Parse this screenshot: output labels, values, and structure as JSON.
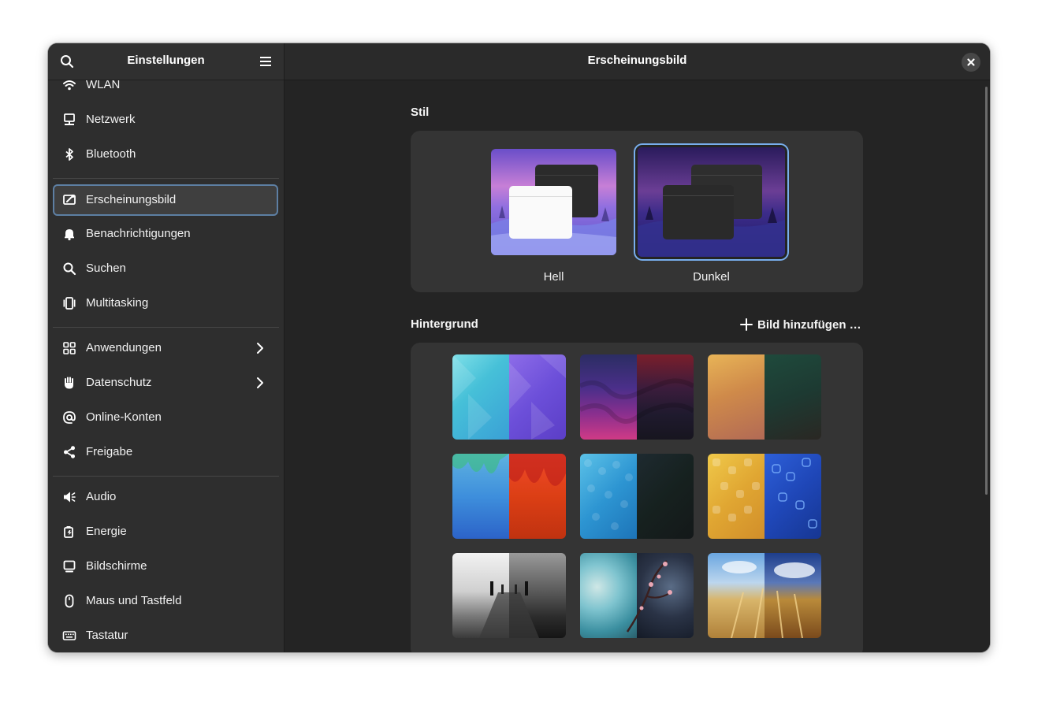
{
  "sidebar": {
    "title": "Einstellungen",
    "search_icon": "search-icon",
    "menu_icon": "hamburger-menu-icon",
    "items": [
      {
        "label": "WLAN",
        "icon": "wifi-icon"
      },
      {
        "label": "Netzwerk",
        "icon": "network-icon"
      },
      {
        "label": "Bluetooth",
        "icon": "bluetooth-icon"
      },
      {
        "label": "Erscheinungsbild",
        "icon": "appearance-icon",
        "active": true
      },
      {
        "label": "Benachrichtigungen",
        "icon": "bell-icon"
      },
      {
        "label": "Suchen",
        "icon": "search-icon"
      },
      {
        "label": "Multitasking",
        "icon": "multitasking-icon"
      },
      {
        "label": "Anwendungen",
        "icon": "apps-grid-icon",
        "submenu": true
      },
      {
        "label": "Datenschutz",
        "icon": "hand-icon",
        "submenu": true
      },
      {
        "label": "Online-Konten",
        "icon": "at-icon"
      },
      {
        "label": "Freigabe",
        "icon": "share-icon"
      },
      {
        "label": "Audio",
        "icon": "speaker-icon"
      },
      {
        "label": "Energie",
        "icon": "battery-icon"
      },
      {
        "label": "Bildschirme",
        "icon": "display-icon"
      },
      {
        "label": "Maus und Tastfeld",
        "icon": "mouse-icon"
      },
      {
        "label": "Tastatur",
        "icon": "keyboard-icon"
      }
    ]
  },
  "content": {
    "title": "Erscheinungsbild",
    "close_icon": "close-icon",
    "style_section": {
      "title": "Stil",
      "options": [
        {
          "label": "Hell",
          "selected": false
        },
        {
          "label": "Dunkel",
          "selected": true
        }
      ]
    },
    "background_section": {
      "title": "Hintergrund",
      "add_label": "Bild hinzufügen …"
    }
  },
  "colors": {
    "accent": "#78aeed",
    "window_bg": "#242424",
    "sidebar_bg": "#2e2e2e",
    "card_bg": "#343434"
  }
}
